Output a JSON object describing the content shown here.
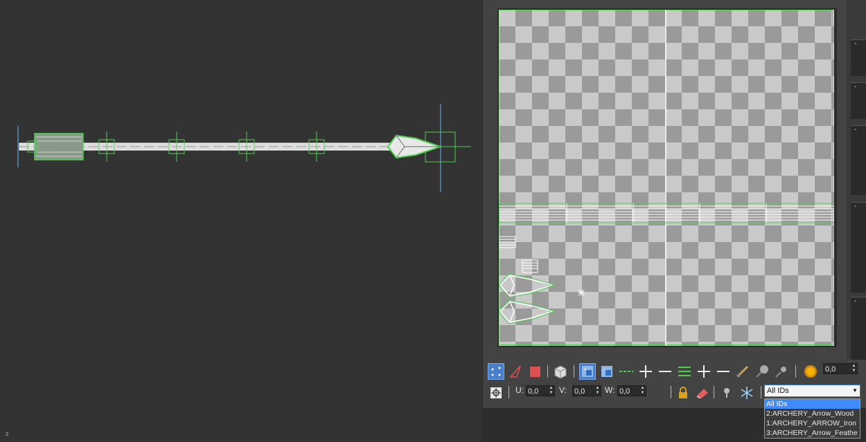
{
  "viewport": {
    "axis_label": "z"
  },
  "uv_toolbar1": {
    "rotate_value": "0,0"
  },
  "uv_toolbar2": {
    "u_label": "U:",
    "u_value": "0,0",
    "v_label": "V:",
    "v_value": "0,0",
    "w_label": "W:",
    "w_value": "0,0"
  },
  "material_id_dropdown": {
    "selected": "All IDs",
    "options": [
      "All IDs",
      "2:ARCHERY_Arrow_Wood",
      "1:ARCHERY_ARROW_Iron",
      "3:ARCHERY_Arrow_Feathe"
    ]
  },
  "rollouts": {
    "collapse_symbol": "-"
  },
  "colors": {
    "wire_green": "#4fd14f",
    "selection_blue": "#3d8bff",
    "wire_white": "#f0f0f0"
  }
}
